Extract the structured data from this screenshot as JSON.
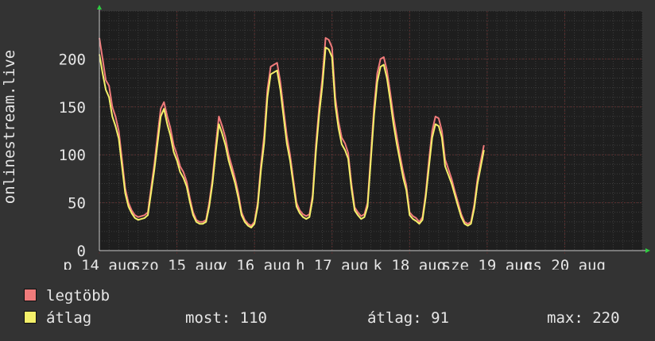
{
  "colors": {
    "background": "#333333",
    "plot": "#1e1e1e",
    "max_series": "#f07b7b",
    "avg_series": "#f4f06a",
    "grid": "#3c3c3c",
    "major_grid": "#5a2e2e",
    "text": "#e6e6e6"
  },
  "legend": [
    {
      "label": "legtöbb",
      "color": "#f07b7b"
    },
    {
      "label": "átlag",
      "color": "#f4f06a"
    }
  ],
  "stats": {
    "most": "most: 110",
    "atlag": "átlag: 91",
    "max": "max: 220"
  },
  "chart_data": {
    "type": "line",
    "ylabel": "onlinestream.live",
    "ylim": [
      0,
      250
    ],
    "yticks": [
      0,
      50,
      100,
      150,
      200
    ],
    "xrange_hours": [
      0,
      168
    ],
    "xticks": [
      {
        "label": "p 14 aug",
        "hour": 0
      },
      {
        "label": "szo 15 aug",
        "hour": 24
      },
      {
        "label": "v 16 aug",
        "hour": 48
      },
      {
        "label": "h 17 aug",
        "hour": 72
      },
      {
        "label": "k 18 aug",
        "hour": 96
      },
      {
        "label": "sze 19 aug",
        "hour": 120
      },
      {
        "label": "cs 20 aug",
        "hour": 144
      }
    ],
    "series": [
      {
        "name": "legtöbb",
        "points": [
          [
            0,
            222
          ],
          [
            1,
            200
          ],
          [
            2,
            178
          ],
          [
            3,
            172
          ],
          [
            4,
            150
          ],
          [
            5,
            140
          ],
          [
            6,
            125
          ],
          [
            7,
            95
          ],
          [
            8,
            65
          ],
          [
            9,
            50
          ],
          [
            10,
            42
          ],
          [
            11,
            37
          ],
          [
            12,
            35
          ],
          [
            13,
            36
          ],
          [
            14,
            37
          ],
          [
            15,
            40
          ],
          [
            16,
            65
          ],
          [
            17,
            90
          ],
          [
            18,
            120
          ],
          [
            19,
            148
          ],
          [
            20,
            155
          ],
          [
            21,
            140
          ],
          [
            22,
            128
          ],
          [
            23,
            110
          ],
          [
            24,
            100
          ],
          [
            25,
            88
          ],
          [
            26,
            82
          ],
          [
            27,
            72
          ],
          [
            28,
            55
          ],
          [
            29,
            40
          ],
          [
            30,
            32
          ],
          [
            31,
            30
          ],
          [
            32,
            30
          ],
          [
            33,
            32
          ],
          [
            34,
            50
          ],
          [
            35,
            75
          ],
          [
            36,
            110
          ],
          [
            37,
            140
          ],
          [
            38,
            130
          ],
          [
            39,
            118
          ],
          [
            40,
            100
          ],
          [
            41,
            88
          ],
          [
            42,
            75
          ],
          [
            43,
            60
          ],
          [
            44,
            40
          ],
          [
            45,
            32
          ],
          [
            46,
            28
          ],
          [
            47,
            26
          ],
          [
            48,
            30
          ],
          [
            49,
            50
          ],
          [
            50,
            90
          ],
          [
            51,
            120
          ],
          [
            52,
            168
          ],
          [
            53,
            192
          ],
          [
            54,
            194
          ],
          [
            55,
            196
          ],
          [
            56,
            176
          ],
          [
            57,
            148
          ],
          [
            58,
            120
          ],
          [
            59,
            100
          ],
          [
            60,
            75
          ],
          [
            61,
            50
          ],
          [
            62,
            42
          ],
          [
            63,
            38
          ],
          [
            64,
            36
          ],
          [
            65,
            38
          ],
          [
            66,
            58
          ],
          [
            67,
            110
          ],
          [
            68,
            150
          ],
          [
            69,
            180
          ],
          [
            70,
            222
          ],
          [
            71,
            220
          ],
          [
            72,
            212
          ],
          [
            73,
            160
          ],
          [
            74,
            135
          ],
          [
            75,
            118
          ],
          [
            76,
            112
          ],
          [
            77,
            102
          ],
          [
            78,
            70
          ],
          [
            79,
            45
          ],
          [
            80,
            40
          ],
          [
            81,
            36
          ],
          [
            82,
            38
          ],
          [
            83,
            50
          ],
          [
            84,
            100
          ],
          [
            85,
            150
          ],
          [
            86,
            185
          ],
          [
            87,
            200
          ],
          [
            88,
            202
          ],
          [
            89,
            188
          ],
          [
            90,
            165
          ],
          [
            91,
            140
          ],
          [
            92,
            120
          ],
          [
            93,
            100
          ],
          [
            94,
            82
          ],
          [
            95,
            68
          ],
          [
            96,
            40
          ],
          [
            97,
            36
          ],
          [
            98,
            34
          ],
          [
            99,
            30
          ],
          [
            100,
            35
          ],
          [
            101,
            60
          ],
          [
            102,
            95
          ],
          [
            103,
            125
          ],
          [
            104,
            140
          ],
          [
            105,
            138
          ],
          [
            106,
            125
          ],
          [
            107,
            95
          ],
          [
            108,
            85
          ],
          [
            109,
            75
          ],
          [
            110,
            62
          ],
          [
            111,
            50
          ],
          [
            112,
            38
          ],
          [
            113,
            30
          ],
          [
            114,
            28
          ],
          [
            115,
            30
          ],
          [
            116,
            48
          ],
          [
            117,
            75
          ],
          [
            118,
            93
          ],
          [
            119,
            110
          ]
        ]
      },
      {
        "name": "átlag",
        "points": [
          [
            0,
            205
          ],
          [
            1,
            185
          ],
          [
            2,
            168
          ],
          [
            3,
            160
          ],
          [
            4,
            140
          ],
          [
            5,
            130
          ],
          [
            6,
            117
          ],
          [
            7,
            88
          ],
          [
            8,
            60
          ],
          [
            9,
            46
          ],
          [
            10,
            39
          ],
          [
            11,
            34
          ],
          [
            12,
            32
          ],
          [
            13,
            33
          ],
          [
            14,
            34
          ],
          [
            15,
            37
          ],
          [
            16,
            60
          ],
          [
            17,
            84
          ],
          [
            18,
            112
          ],
          [
            19,
            140
          ],
          [
            20,
            148
          ],
          [
            21,
            132
          ],
          [
            22,
            120
          ],
          [
            23,
            103
          ],
          [
            24,
            94
          ],
          [
            25,
            82
          ],
          [
            26,
            76
          ],
          [
            27,
            67
          ],
          [
            28,
            51
          ],
          [
            29,
            37
          ],
          [
            30,
            30
          ],
          [
            31,
            28
          ],
          [
            32,
            28
          ],
          [
            33,
            30
          ],
          [
            34,
            46
          ],
          [
            35,
            70
          ],
          [
            36,
            103
          ],
          [
            37,
            132
          ],
          [
            38,
            122
          ],
          [
            39,
            110
          ],
          [
            40,
            94
          ],
          [
            41,
            82
          ],
          [
            42,
            70
          ],
          [
            43,
            55
          ],
          [
            44,
            37
          ],
          [
            45,
            30
          ],
          [
            46,
            26
          ],
          [
            47,
            24
          ],
          [
            48,
            28
          ],
          [
            49,
            46
          ],
          [
            50,
            84
          ],
          [
            51,
            112
          ],
          [
            52,
            160
          ],
          [
            53,
            184
          ],
          [
            54,
            186
          ],
          [
            55,
            188
          ],
          [
            56,
            168
          ],
          [
            57,
            140
          ],
          [
            58,
            112
          ],
          [
            59,
            94
          ],
          [
            60,
            70
          ],
          [
            61,
            46
          ],
          [
            62,
            39
          ],
          [
            63,
            35
          ],
          [
            64,
            33
          ],
          [
            65,
            35
          ],
          [
            66,
            54
          ],
          [
            67,
            103
          ],
          [
            68,
            142
          ],
          [
            69,
            172
          ],
          [
            70,
            212
          ],
          [
            71,
            210
          ],
          [
            72,
            202
          ],
          [
            73,
            152
          ],
          [
            74,
            128
          ],
          [
            75,
            111
          ],
          [
            76,
            105
          ],
          [
            77,
            96
          ],
          [
            78,
            65
          ],
          [
            79,
            42
          ],
          [
            80,
            37
          ],
          [
            81,
            33
          ],
          [
            82,
            35
          ],
          [
            83,
            46
          ],
          [
            84,
            94
          ],
          [
            85,
            142
          ],
          [
            86,
            176
          ],
          [
            87,
            192
          ],
          [
            88,
            194
          ],
          [
            89,
            180
          ],
          [
            90,
            157
          ],
          [
            91,
            132
          ],
          [
            92,
            112
          ],
          [
            93,
            94
          ],
          [
            94,
            76
          ],
          [
            95,
            63
          ],
          [
            96,
            37
          ],
          [
            97,
            33
          ],
          [
            98,
            31
          ],
          [
            99,
            28
          ],
          [
            100,
            32
          ],
          [
            101,
            56
          ],
          [
            102,
            88
          ],
          [
            103,
            118
          ],
          [
            104,
            132
          ],
          [
            105,
            130
          ],
          [
            106,
            118
          ],
          [
            107,
            88
          ],
          [
            108,
            79
          ],
          [
            109,
            70
          ],
          [
            110,
            58
          ],
          [
            111,
            46
          ],
          [
            112,
            35
          ],
          [
            113,
            28
          ],
          [
            114,
            26
          ],
          [
            115,
            28
          ],
          [
            116,
            44
          ],
          [
            117,
            70
          ],
          [
            118,
            87
          ],
          [
            119,
            105
          ]
        ]
      }
    ]
  }
}
